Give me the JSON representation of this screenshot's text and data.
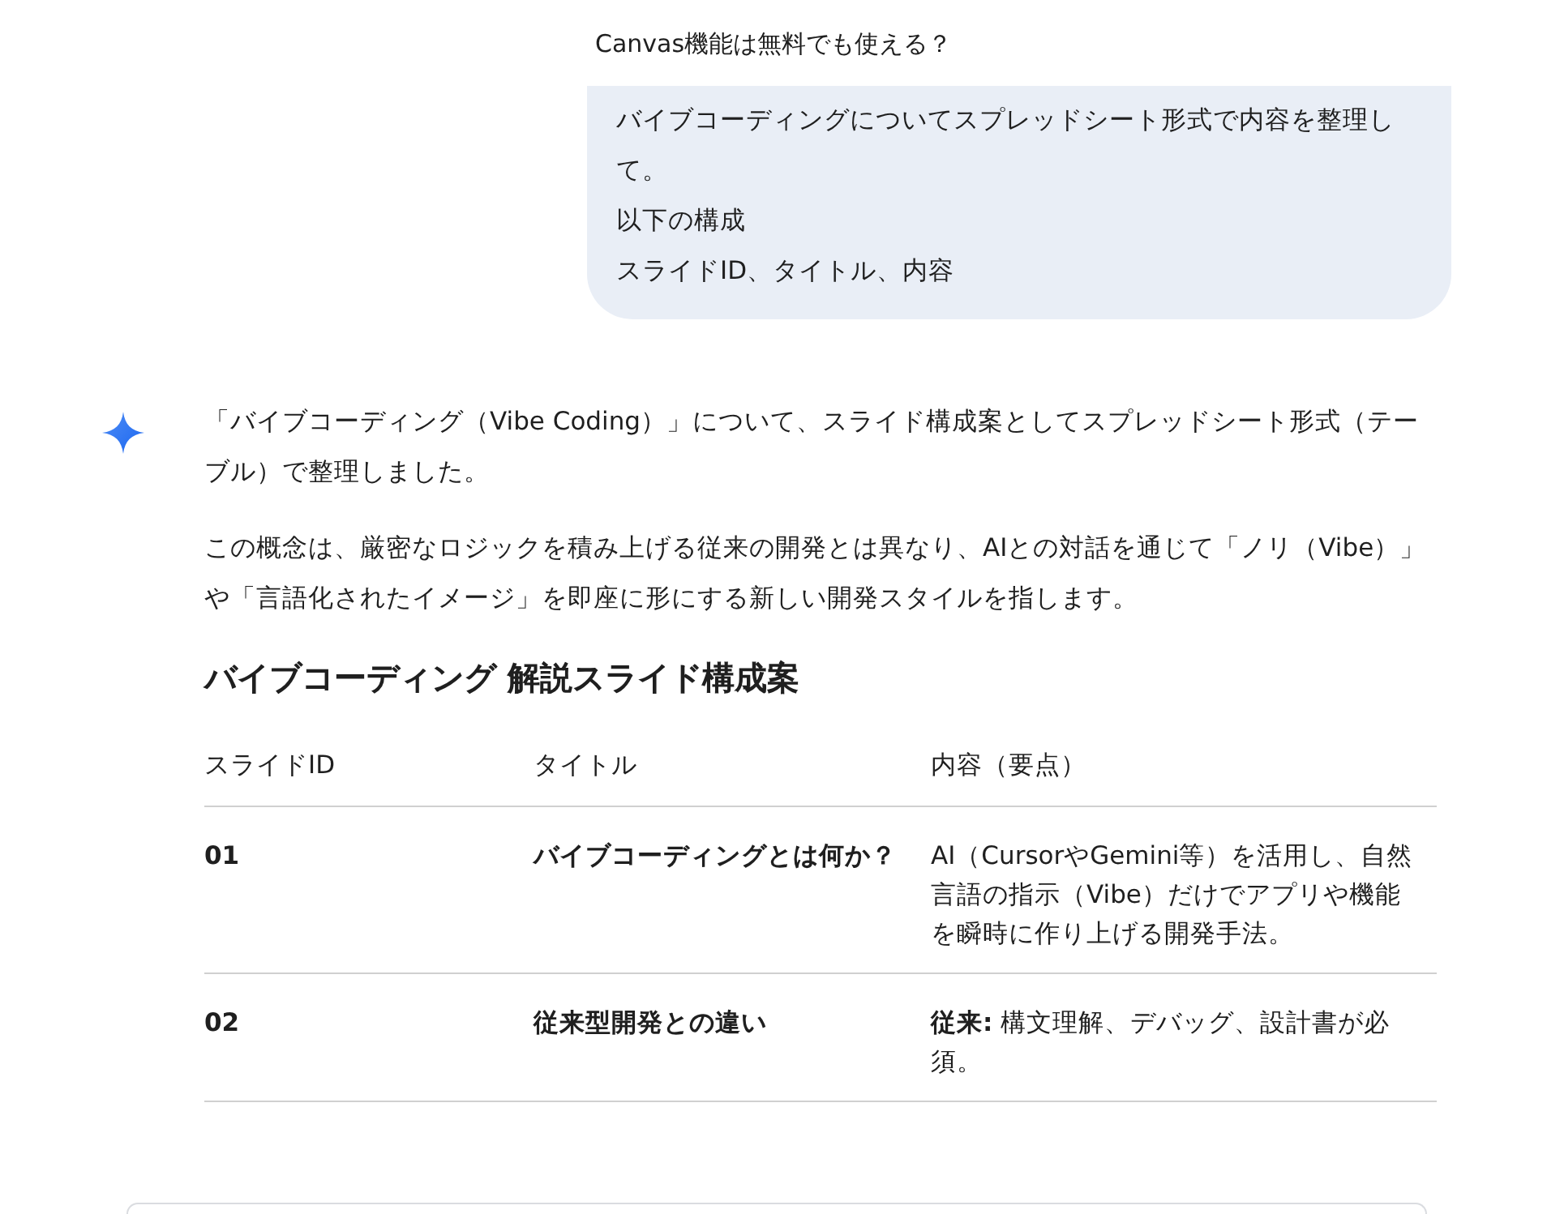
{
  "prior_prompt": "Canvas機能は無料でも使える？",
  "user_message": {
    "lines": [
      "バイブコーディングについてスプレッドシート形式で内容を整理して。",
      "以下の構成",
      "スライドID、タイトル、内容"
    ]
  },
  "response": {
    "paragraphs": [
      "「バイブコーディング（Vibe Coding）」について、スライド構成案としてスプレッドシート形式（テーブル）で整理しました。",
      "この概念は、厳密なロジックを積み上げる従来の開発とは異なり、AIとの対話を通じて「ノリ（Vibe）」や「言語化されたイメージ」を即座に形にする新しい開発スタイルを指します。"
    ],
    "heading": "バイブコーディング 解説スライド構成案",
    "table": {
      "columns": [
        "スライドID",
        "タイトル",
        "内容（要点）"
      ],
      "rows": [
        {
          "id": "01",
          "title": "バイブコーディングとは何か？",
          "content": "AI（CursorやGemini等）を活用し、自然言語の指示（Vibe）だけでアプリや機能を瞬時に作り上げる開発手法。"
        },
        {
          "id": "02",
          "title": "従来型開発との違い",
          "content": "**従来:** 構文理解、デバッグ、設計書が必須。"
        }
      ]
    }
  }
}
